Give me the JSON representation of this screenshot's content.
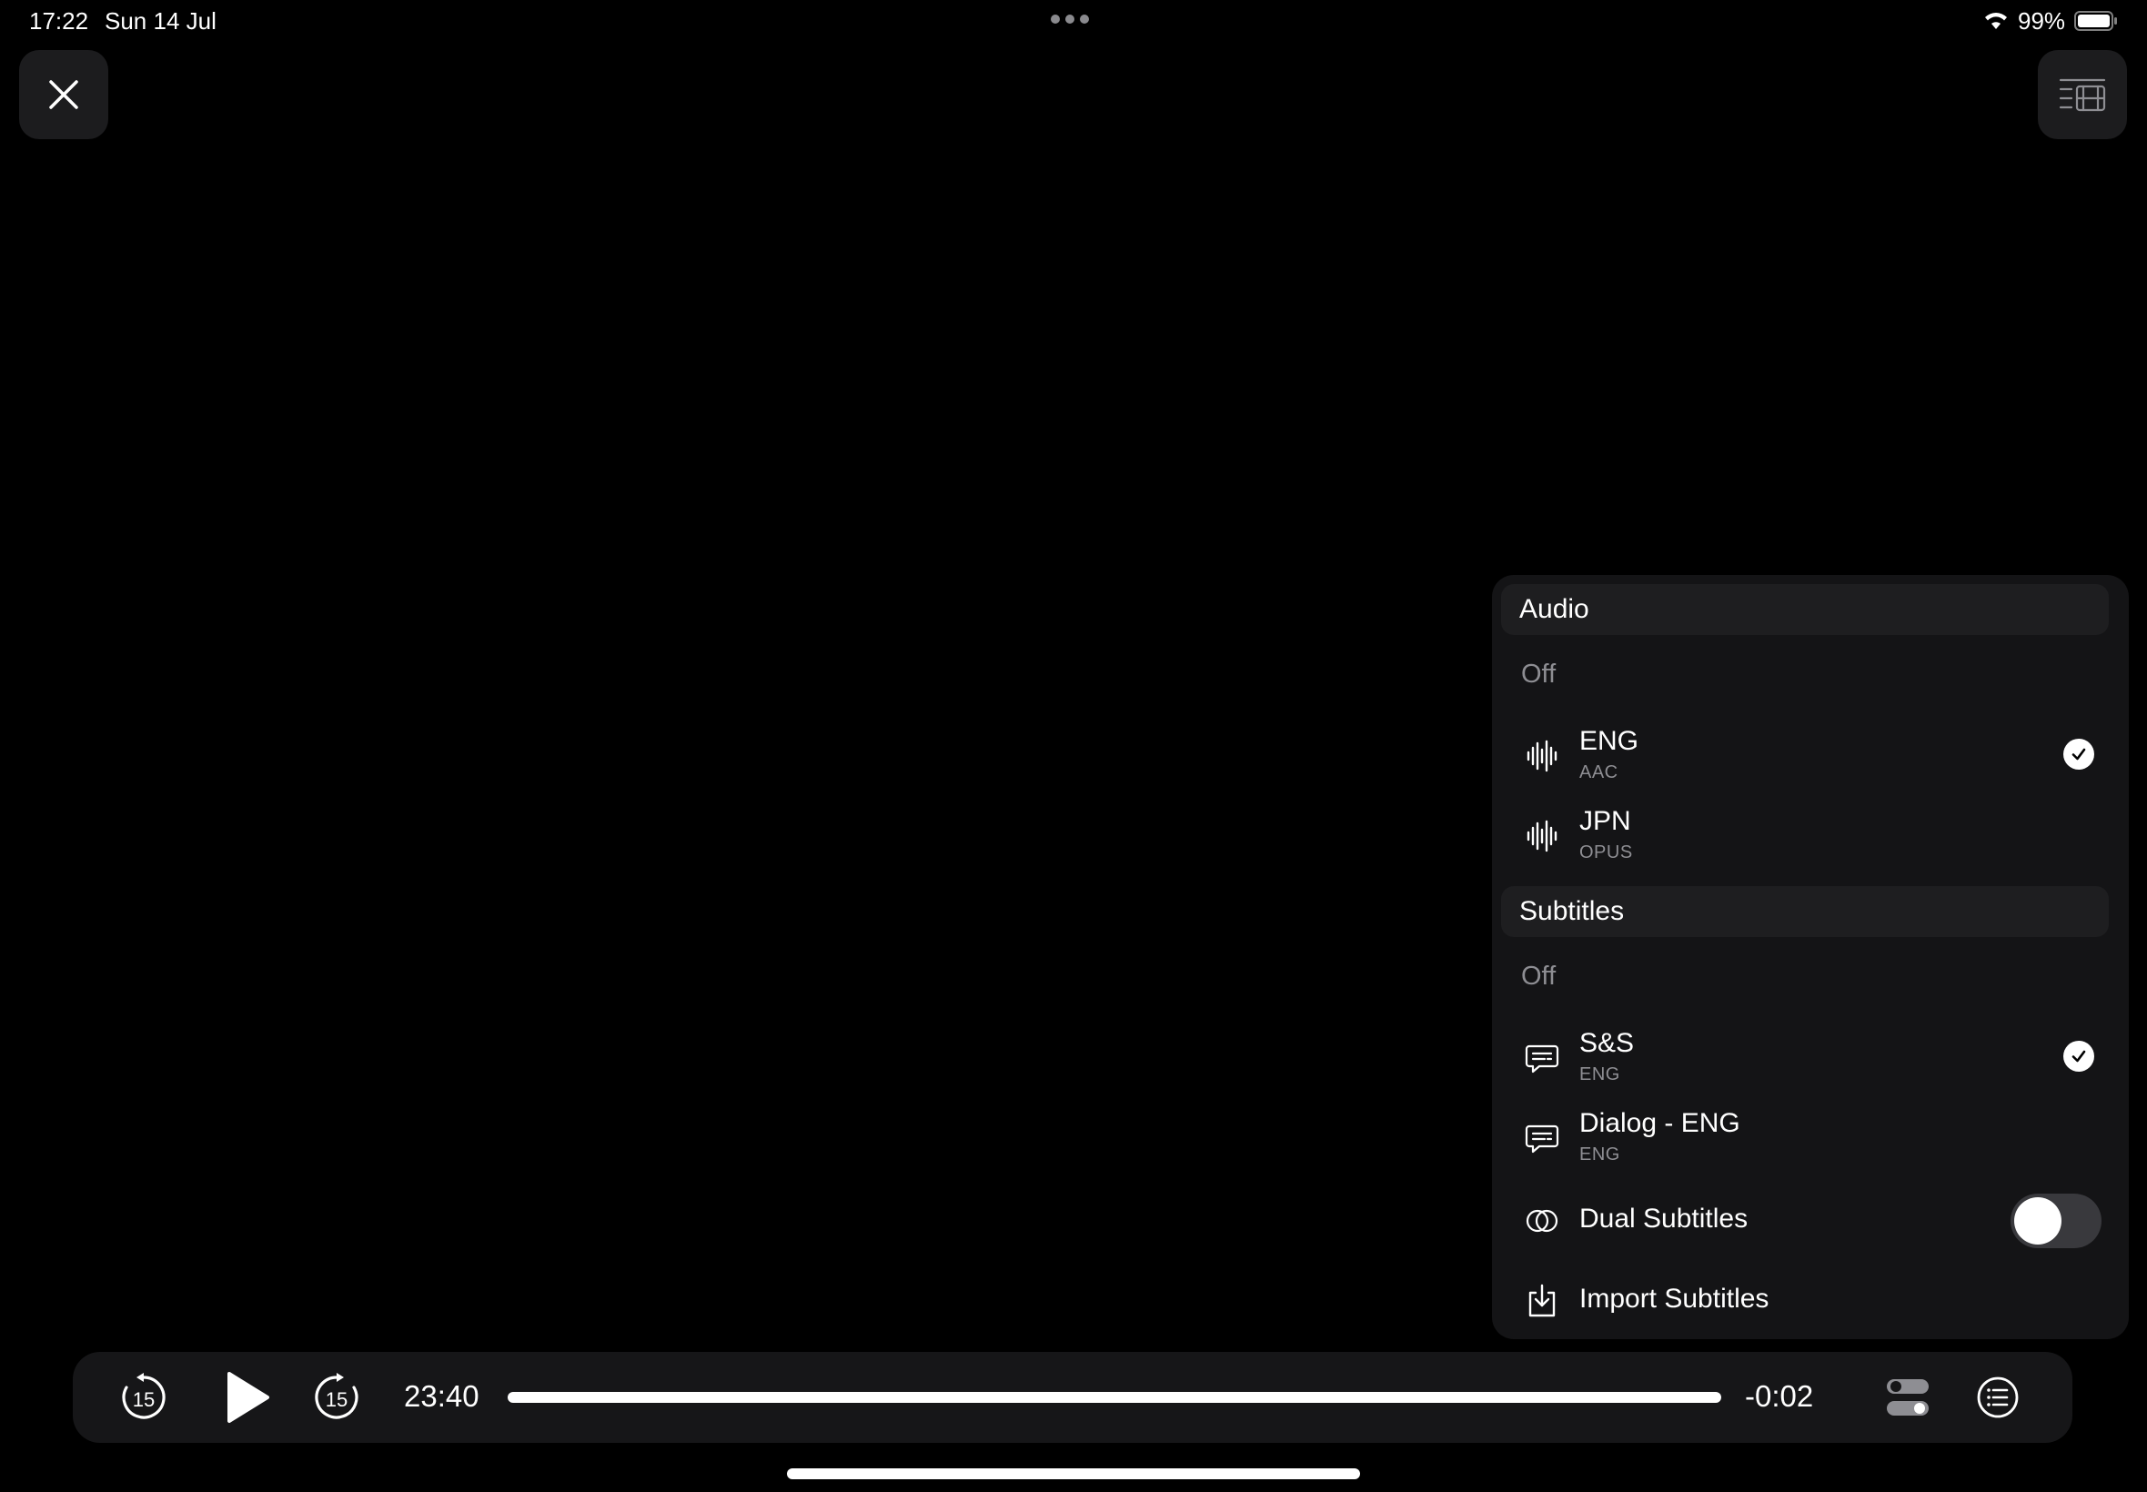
{
  "status_bar": {
    "time": "17:22",
    "date": "Sun 14 Jul",
    "battery": "99%"
  },
  "icons": {
    "close": "close-icon",
    "episodes": "episodes-list-icon",
    "audio_track": "waveform-icon",
    "subtitle_track": "speech-bubble-icon",
    "dual_subtitles": "dual-circles-icon",
    "import": "import-tray-icon",
    "skip_back": "rewind-15-icon",
    "play": "play-icon",
    "skip_forward": "forward-15-icon",
    "settings": "toggles-icon",
    "menu": "list-circle-icon"
  },
  "panel": {
    "audio": {
      "header": "Audio",
      "off_label": "Off",
      "tracks": [
        {
          "name": "ENG",
          "codec": "AAC",
          "selected": true
        },
        {
          "name": "JPN",
          "codec": "OPUS",
          "selected": false
        }
      ]
    },
    "subtitles": {
      "header": "Subtitles",
      "off_label": "Off",
      "tracks": [
        {
          "name": "S&S",
          "lang": "ENG",
          "selected": true
        },
        {
          "name": "Dialog - ENG",
          "lang": "ENG",
          "selected": false
        }
      ],
      "dual_label": "Dual Subtitles",
      "dual_enabled": false,
      "import_label": "Import Subtitles"
    }
  },
  "transport": {
    "skip_back_seconds": "15",
    "skip_forward_seconds": "15",
    "elapsed": "23:40",
    "remaining": "-0:02",
    "progress": 0.999
  },
  "colors": {
    "background": "#000000",
    "panel": "#141416",
    "accent": "#ffffff"
  }
}
